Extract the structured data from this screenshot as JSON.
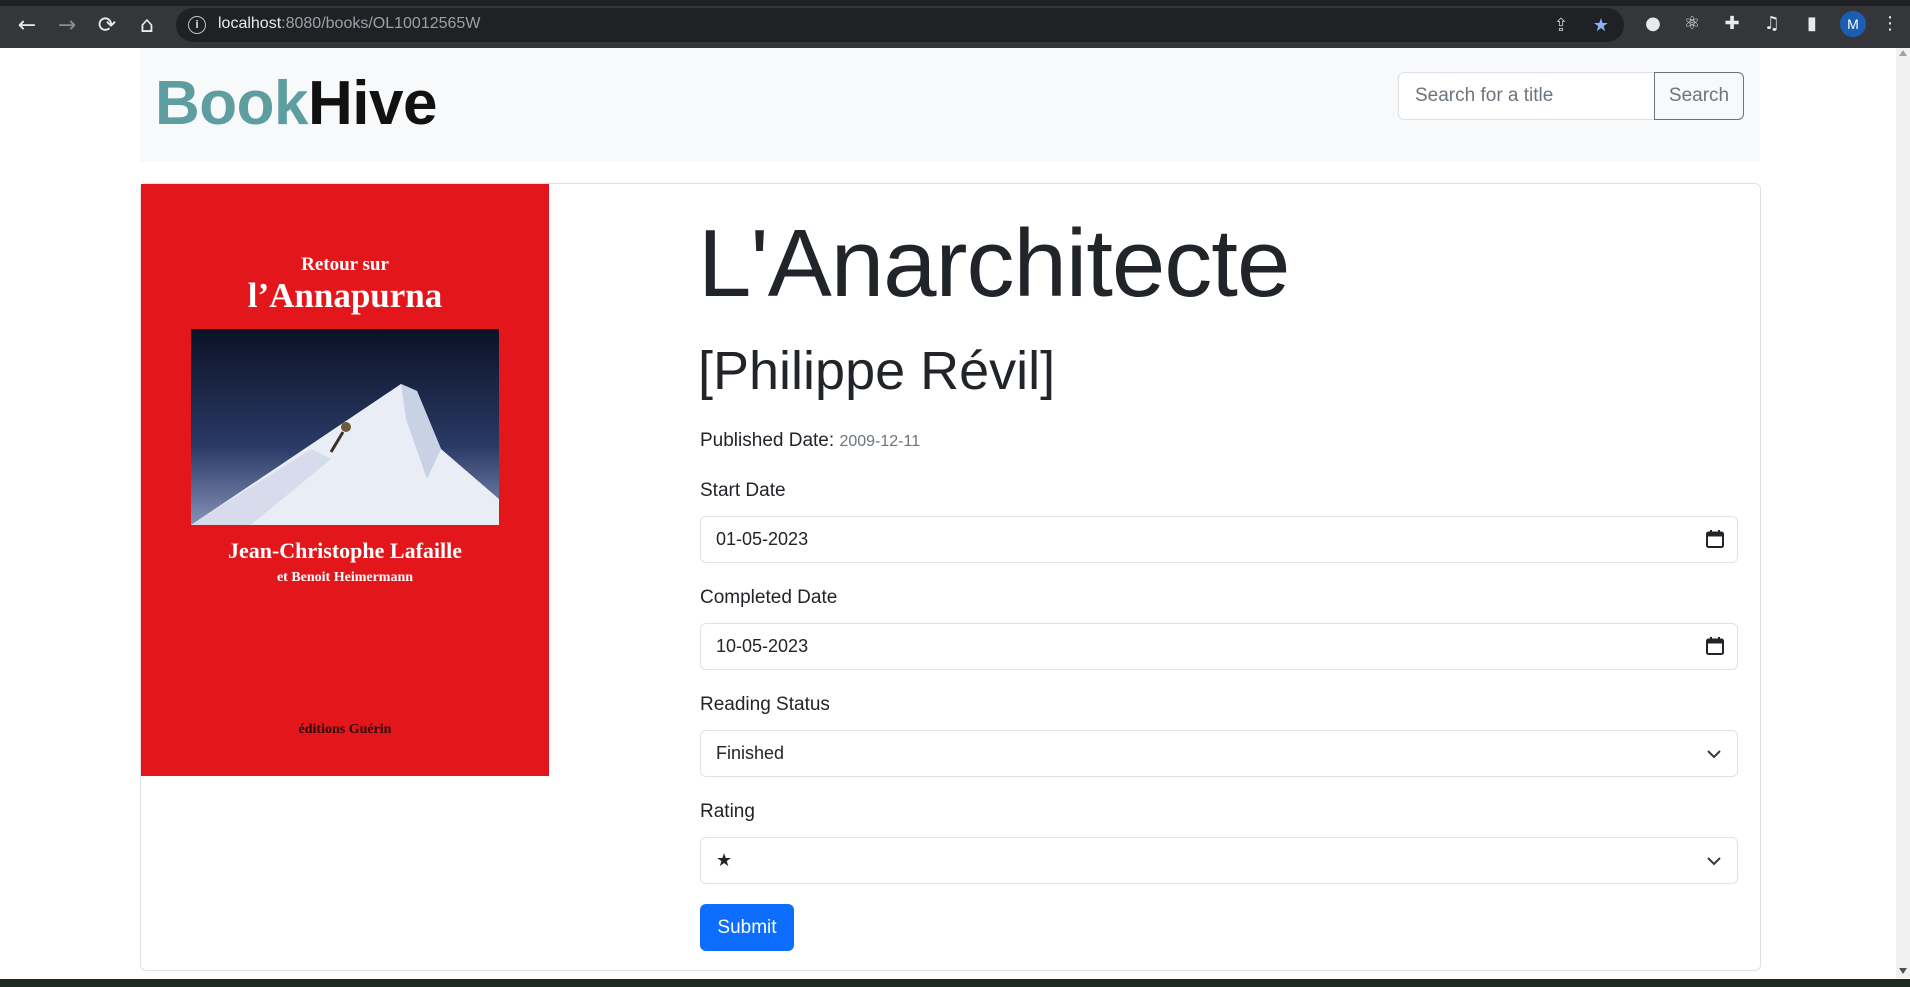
{
  "browser": {
    "url_host": "localhost",
    "url_rest": ":8080/books/OL10012565W",
    "profile_initial": "M",
    "icons": [
      "back-icon",
      "forward-icon",
      "reload-icon",
      "home-icon",
      "info-icon",
      "share-icon",
      "star-icon",
      "extension-icon",
      "react-icon",
      "puzzle-icon",
      "media-icon",
      "side-panel-icon",
      "menu-icon"
    ],
    "accent": "#8ab4f8"
  },
  "header": {
    "brand_part1": "Book",
    "brand_part2": "Hive",
    "brand_color": "#5f9ea0",
    "search_placeholder": "Search for a title",
    "search_button": "Search"
  },
  "cover": {
    "line1": "Retour sur",
    "line2": "l’Annapurna",
    "author_line": "Jean-Christophe Lafaille",
    "coauthor_line": "et Benoit Heimermann",
    "publisher": "éditions Guérin",
    "background": "#e3161c"
  },
  "book": {
    "title": "L'Anarchitecte",
    "author": "[Philippe Révil]",
    "published_label": "Published Date:",
    "published_value": "2009-12-11"
  },
  "form": {
    "start_label": "Start Date",
    "start_value": "01-05-2023",
    "completed_label": "Completed Date",
    "completed_value": "10-05-2023",
    "status_label": "Reading Status",
    "status_value": "Finished",
    "rating_label": "Rating",
    "rating_value": "★",
    "submit_label": "Submit",
    "submit_color": "#0d6efd"
  }
}
